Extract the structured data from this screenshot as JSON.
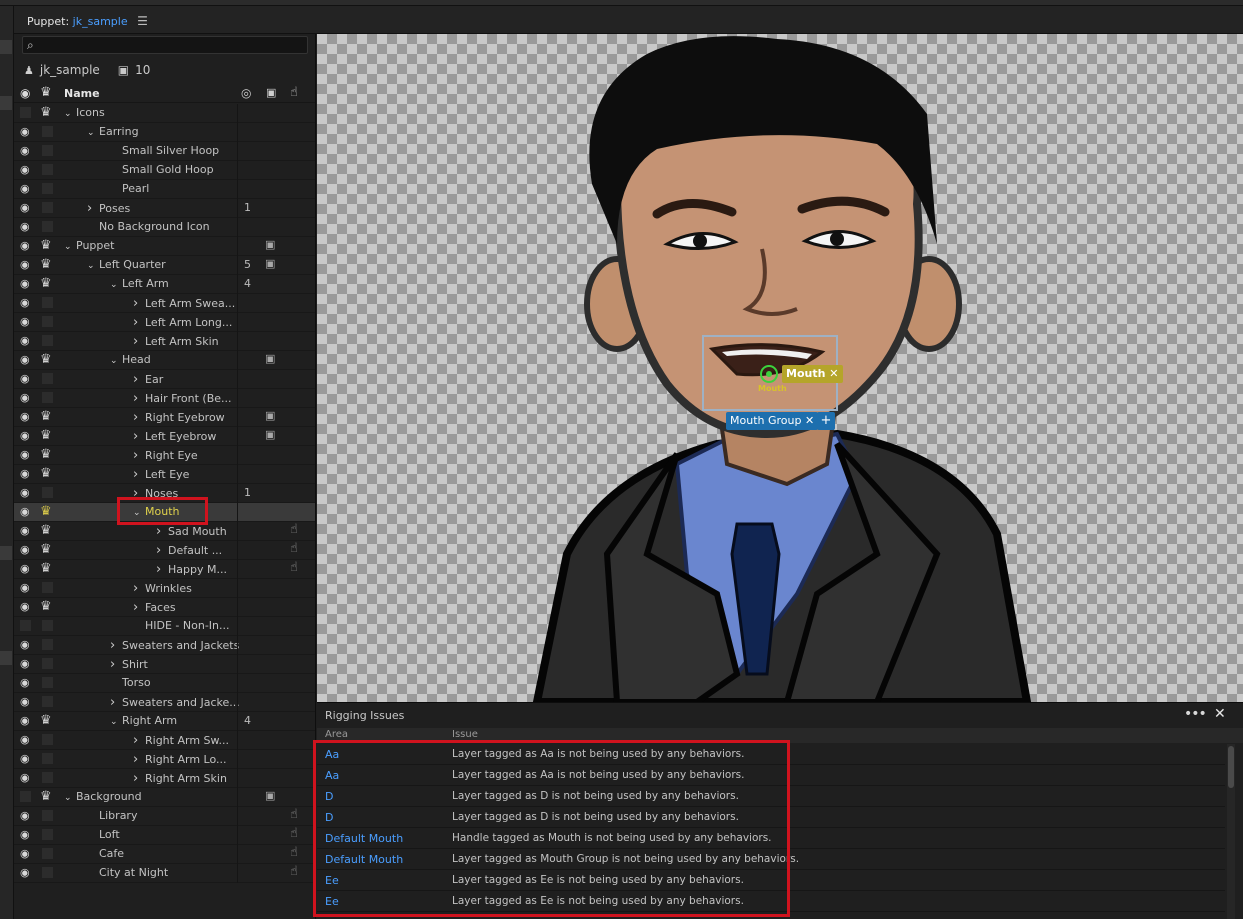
{
  "panel": {
    "label": "Puppet:",
    "name": "jk_sample",
    "menu_icon": "hamburger-icon"
  },
  "puppet": {
    "name": "jk_sample",
    "count": "10"
  },
  "columns": {
    "name": "Name"
  },
  "tree": [
    {
      "name": "Icons",
      "indent": 0,
      "chev": "v",
      "eye": false,
      "crown": true
    },
    {
      "name": "Earring",
      "indent": 1,
      "chev": "v",
      "eye": true
    },
    {
      "name": "Small Silver Hoop",
      "indent": 2,
      "eye": true
    },
    {
      "name": "Small Gold Hoop",
      "indent": 2,
      "eye": true
    },
    {
      "name": "Pearl",
      "indent": 2,
      "eye": true
    },
    {
      "name": "Poses",
      "indent": 1,
      "chev": ">",
      "eye": true,
      "num": "1"
    },
    {
      "name": "No Background Icon",
      "indent": 1,
      "eye": true
    },
    {
      "name": "Puppet",
      "indent": 0,
      "chev": "v",
      "eye": true,
      "crown": true,
      "cam": true
    },
    {
      "name": "Left Quarter",
      "indent": 1,
      "chev": "v",
      "eye": true,
      "crown": true,
      "num": "5",
      "cam": true
    },
    {
      "name": "Left Arm",
      "indent": 2,
      "chev": "v",
      "eye": true,
      "crown": true,
      "num": "4"
    },
    {
      "name": "Left Arm Swea...",
      "indent": 3,
      "chev": ">",
      "eye": true
    },
    {
      "name": "Left Arm Long...",
      "indent": 3,
      "chev": ">",
      "eye": true
    },
    {
      "name": "Left Arm Skin",
      "indent": 3,
      "chev": ">",
      "eye": true
    },
    {
      "name": "Head",
      "indent": 2,
      "chev": "v",
      "eye": true,
      "crown": true,
      "cam": true
    },
    {
      "name": "Ear",
      "indent": 3,
      "chev": ">",
      "eye": true
    },
    {
      "name": "Hair Front (Be...",
      "indent": 3,
      "chev": ">",
      "eye": true
    },
    {
      "name": "Right Eyebrow",
      "indent": 3,
      "chev": ">",
      "eye": true,
      "crown": true,
      "cam": true
    },
    {
      "name": "Left Eyebrow",
      "indent": 3,
      "chev": ">",
      "eye": true,
      "crown": true,
      "cam": true
    },
    {
      "name": "Right Eye",
      "indent": 3,
      "chev": ">",
      "eye": true,
      "crown": true
    },
    {
      "name": "Left Eye",
      "indent": 3,
      "chev": ">",
      "eye": true,
      "crown": true
    },
    {
      "name": "Noses",
      "indent": 3,
      "chev": ">",
      "eye": true,
      "num": "1"
    },
    {
      "name": "Mouth",
      "indent": 3,
      "chev": "v",
      "eye": true,
      "crown": true,
      "gold": true,
      "selected": true
    },
    {
      "name": "Sad Mouth",
      "indent": 4,
      "chev": ">",
      "eye": true,
      "crown": true,
      "hand": true
    },
    {
      "name": "Default ...",
      "indent": 4,
      "chev": ">",
      "eye": true,
      "crown": true,
      "hand": true
    },
    {
      "name": "Happy M...",
      "indent": 4,
      "chev": ">",
      "eye": true,
      "crown": true,
      "hand": true
    },
    {
      "name": "Wrinkles",
      "indent": 3,
      "chev": ">",
      "eye": true
    },
    {
      "name": "Faces",
      "indent": 3,
      "chev": ">",
      "eye": true,
      "crown": true
    },
    {
      "name": "HIDE - Non-In...",
      "indent": 3,
      "eye": false
    },
    {
      "name": "Sweaters and Jackets",
      "indent": 2,
      "chev": ">",
      "eye": true
    },
    {
      "name": "Shirt",
      "indent": 2,
      "chev": ">",
      "eye": true
    },
    {
      "name": "Torso",
      "indent": 2,
      "eye": true
    },
    {
      "name": "Sweaters and Jacke...",
      "indent": 2,
      "chev": ">",
      "eye": true
    },
    {
      "name": "Right Arm",
      "indent": 2,
      "chev": "v",
      "eye": true,
      "crown": true,
      "num": "4"
    },
    {
      "name": "Right Arm Sw...",
      "indent": 3,
      "chev": ">",
      "eye": true
    },
    {
      "name": "Right Arm Lo...",
      "indent": 3,
      "chev": ">",
      "eye": true
    },
    {
      "name": "Right Arm Skin",
      "indent": 3,
      "chev": ">",
      "eye": true
    },
    {
      "name": "Background",
      "indent": 0,
      "chev": "v",
      "eye": false,
      "crown": true,
      "cam": true
    },
    {
      "name": "Library",
      "indent": 1,
      "eye": true,
      "hand": true
    },
    {
      "name": "Loft",
      "indent": 1,
      "eye": true,
      "hand": true
    },
    {
      "name": "Cafe",
      "indent": 1,
      "eye": true,
      "hand": true
    },
    {
      "name": "City at Night",
      "indent": 1,
      "eye": true,
      "hand": true
    }
  ],
  "canvas": {
    "tags": {
      "mouth": "Mouth",
      "mouth_small": "Mouth",
      "group": "Mouth Group",
      "close": "✕",
      "plus": "+"
    }
  },
  "issues": {
    "title": "Rigging Issues",
    "col_area": "Area",
    "col_issue": "Issue",
    "rows": [
      {
        "area": "Aa",
        "issue": "Layer tagged as Aa is not being used by any behaviors."
      },
      {
        "area": "Aa",
        "issue": "Layer tagged as Aa is not being used by any behaviors."
      },
      {
        "area": "D",
        "issue": "Layer tagged as D is not being used by any behaviors."
      },
      {
        "area": "D",
        "issue": "Layer tagged as D is not being used by any behaviors."
      },
      {
        "area": "Default Mouth",
        "issue": "Handle tagged as Mouth is not being used by any behaviors."
      },
      {
        "area": "Default Mouth",
        "issue": "Layer tagged as Mouth Group is not being used by any behaviors."
      },
      {
        "area": "Ee",
        "issue": "Layer tagged as Ee is not being used by any behaviors."
      },
      {
        "area": "Ee",
        "issue": "Layer tagged as Ee is not being used by any behaviors."
      }
    ]
  },
  "colors": {
    "accent": "#4a9eff",
    "highlight_red": "#d0131e",
    "tag_yellow": "#b5a52a",
    "tag_blue": "#1d6fae"
  }
}
